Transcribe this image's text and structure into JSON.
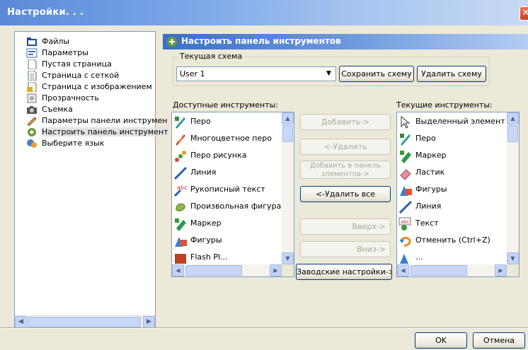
{
  "window": {
    "title": "Настройки. . .",
    "close_glyph": "✕"
  },
  "tree": {
    "items": [
      {
        "label": "Файлы",
        "icon": "folder-icon"
      },
      {
        "label": "Параметры",
        "icon": "options-icon"
      },
      {
        "label": "Пустая страница",
        "icon": "blank-page-icon"
      },
      {
        "label": "Страница с сеткой",
        "icon": "grid-page-icon"
      },
      {
        "label": "Страница с изображением",
        "icon": "image-page-icon"
      },
      {
        "label": "Прозрачность",
        "icon": "transparency-icon"
      },
      {
        "label": "Съемка",
        "icon": "camera-icon"
      },
      {
        "label": "Параметры панели инструмен",
        "icon": "toolbar-settings-icon"
      },
      {
        "label": "Настроить панель инструмент",
        "icon": "customize-toolbar-icon",
        "selected": true
      },
      {
        "label": "Выберите язык",
        "icon": "language-icon"
      }
    ]
  },
  "panel": {
    "title": "Настроить панель инструментов",
    "scheme_group": {
      "legend": "Текущая схема",
      "selected": "User 1",
      "save_label": "Сохранить схему",
      "delete_label": "Удалить схему"
    },
    "available_label": "Доступные инструменты:",
    "current_label": "Текущие инструменты:",
    "available_tools": [
      "Перо",
      "Многоцветное перо",
      "Перо рисунка",
      "Линия",
      "Рукописный текст",
      "Произвольная фигура",
      "Маркер",
      "Фигуры",
      "Flash Pl..."
    ],
    "current_tools": [
      "Выделенный элемент",
      "Перо",
      "Маркер",
      "Ластик",
      "Фигуры",
      "Линия",
      "Текст",
      "Отменить (Ctrl+Z)",
      "..."
    ],
    "buttons": {
      "add": "Добавить->",
      "remove": "<-Удалить",
      "add_panel_line1": "Добавить в панель",
      "add_panel_line2": "элементов->",
      "remove_all": "<-Удалить все",
      "up": "Вверх->",
      "down": "Вниз->",
      "defaults": "Заводские настройки->"
    }
  },
  "footer": {
    "ok": "OK",
    "cancel": "Отмена"
  },
  "colors": {
    "title_bar": "#5a8ad8",
    "panel_header": "#3b6ec7",
    "dialog_bg": "#ece9d8"
  }
}
